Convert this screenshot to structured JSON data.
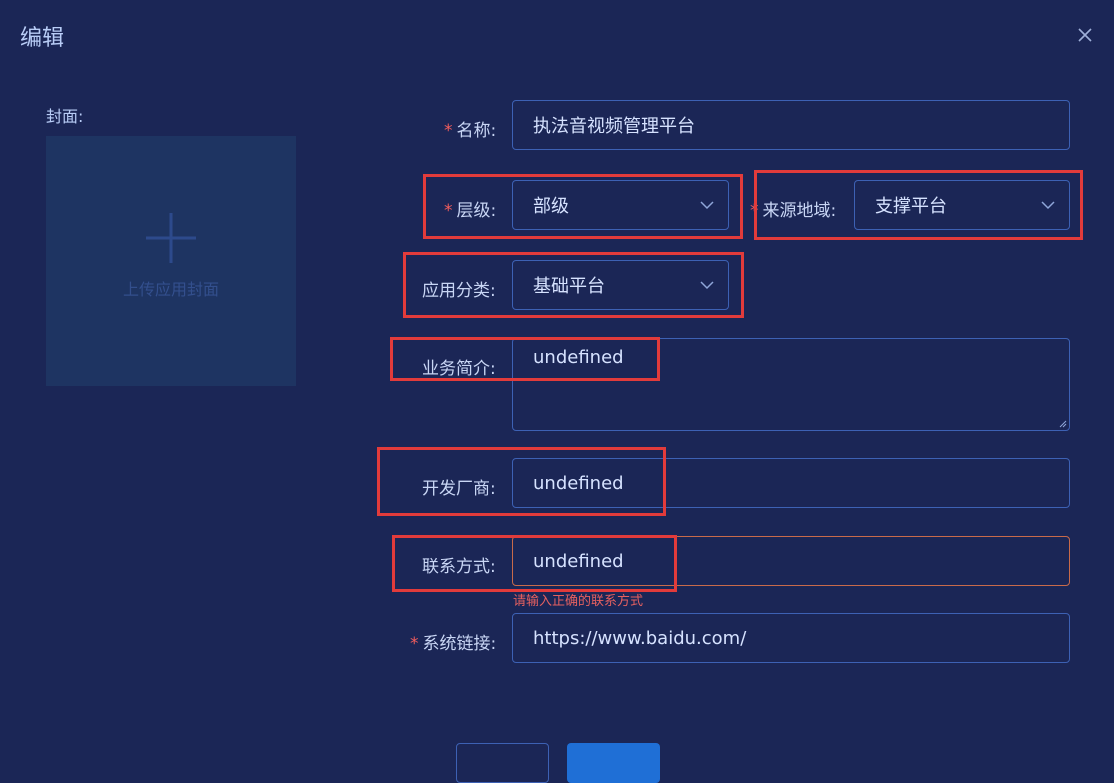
{
  "dialog": {
    "title": "编辑",
    "close_icon": "close-icon"
  },
  "cover": {
    "label": "封面:",
    "upload_text": "上传应用封面",
    "upload_icon": "plus-icon"
  },
  "form": {
    "name": {
      "label": "名称:",
      "required": "*",
      "value": "执法音视频管理平台"
    },
    "level": {
      "label": "层级:",
      "required": "*",
      "value": "部级"
    },
    "source_region": {
      "label": "来源地域:",
      "required": "*",
      "value": "支撑平台"
    },
    "category": {
      "label": "应用分类:",
      "value": "基础平台"
    },
    "description": {
      "label": "业务简介:",
      "value": "undefined"
    },
    "vendor": {
      "label": "开发厂商:",
      "value": "undefined"
    },
    "contact": {
      "label": "联系方式:",
      "value": "undefined",
      "error": "请输入正确的联系方式"
    },
    "link": {
      "label": "系统链接:",
      "required": "*",
      "value": "https://www.baidu.com/"
    }
  },
  "colors": {
    "background": "#1b2656",
    "input_border": "#3d61b4",
    "highlight_box": "#e23b3b",
    "error": "#e56060",
    "primary": "#1f6fd6"
  }
}
